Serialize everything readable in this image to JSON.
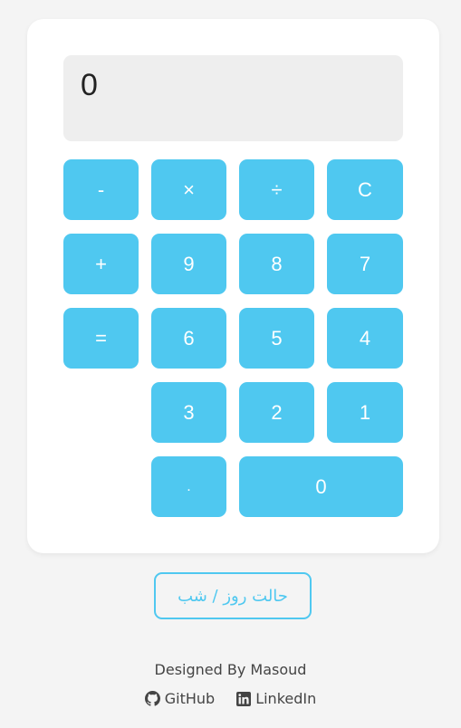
{
  "display": {
    "value": "0"
  },
  "keys": {
    "minus": "-",
    "multiply": "×",
    "divide": "÷",
    "clear": "C",
    "plus": "+",
    "nine": "9",
    "eight": "8",
    "seven": "7",
    "equals": "=",
    "six": "6",
    "five": "5",
    "four": "4",
    "three": "3",
    "two": "2",
    "one": "1",
    "dot": ".",
    "zero": "0"
  },
  "mode_toggle": {
    "label": "حالت روز / شب"
  },
  "footer": {
    "credit": "Designed By Masoud",
    "github_label": "GitHub",
    "github_icon": "github-icon",
    "linkedin_label": "LinkedIn",
    "linkedin_icon": "linkedin-icon"
  },
  "colors": {
    "accent": "#4fc8f0",
    "display_bg": "#eeeeee",
    "page_bg": "#f4f4f4"
  }
}
